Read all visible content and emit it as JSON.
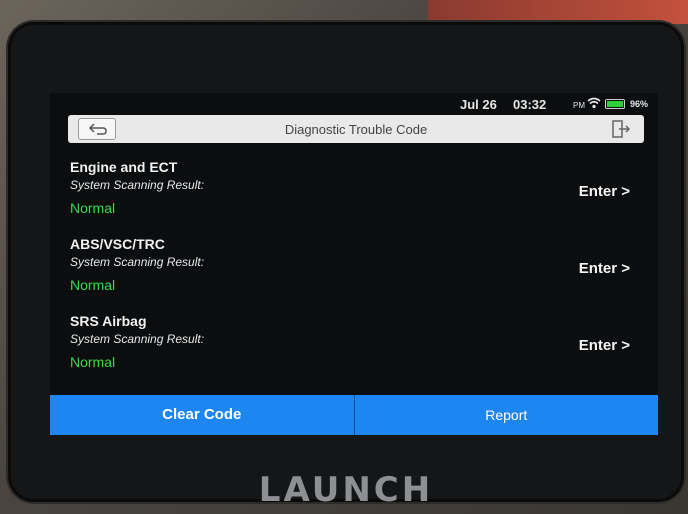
{
  "status": {
    "date": "Jul 26",
    "time": "03:32",
    "ampm": "PM",
    "battery": "96%"
  },
  "header": {
    "title": "Diagnostic Trouble Code"
  },
  "systems": [
    {
      "name": "Engine and ECT",
      "result_label": "System Scanning Result:",
      "result": "Normal",
      "action": "Enter >"
    },
    {
      "name": "ABS/VSC/TRC",
      "result_label": "System Scanning Result:",
      "result": "Normal",
      "action": "Enter >"
    },
    {
      "name": "SRS Airbag",
      "result_label": "System Scanning Result:",
      "result": "Normal",
      "action": "Enter >"
    }
  ],
  "footer": {
    "clear_label": "Clear Code",
    "report_label": "Report"
  },
  "device": {
    "brand": "LAUNCH"
  },
  "colors": {
    "accent": "#1e86f0",
    "normal": "#38d94d",
    "battery": "#2fcf3a"
  },
  "icons": {
    "back": "back-arrow-icon",
    "exit": "exit-icon",
    "wifi": "wifi-icon",
    "battery": "battery-icon"
  }
}
